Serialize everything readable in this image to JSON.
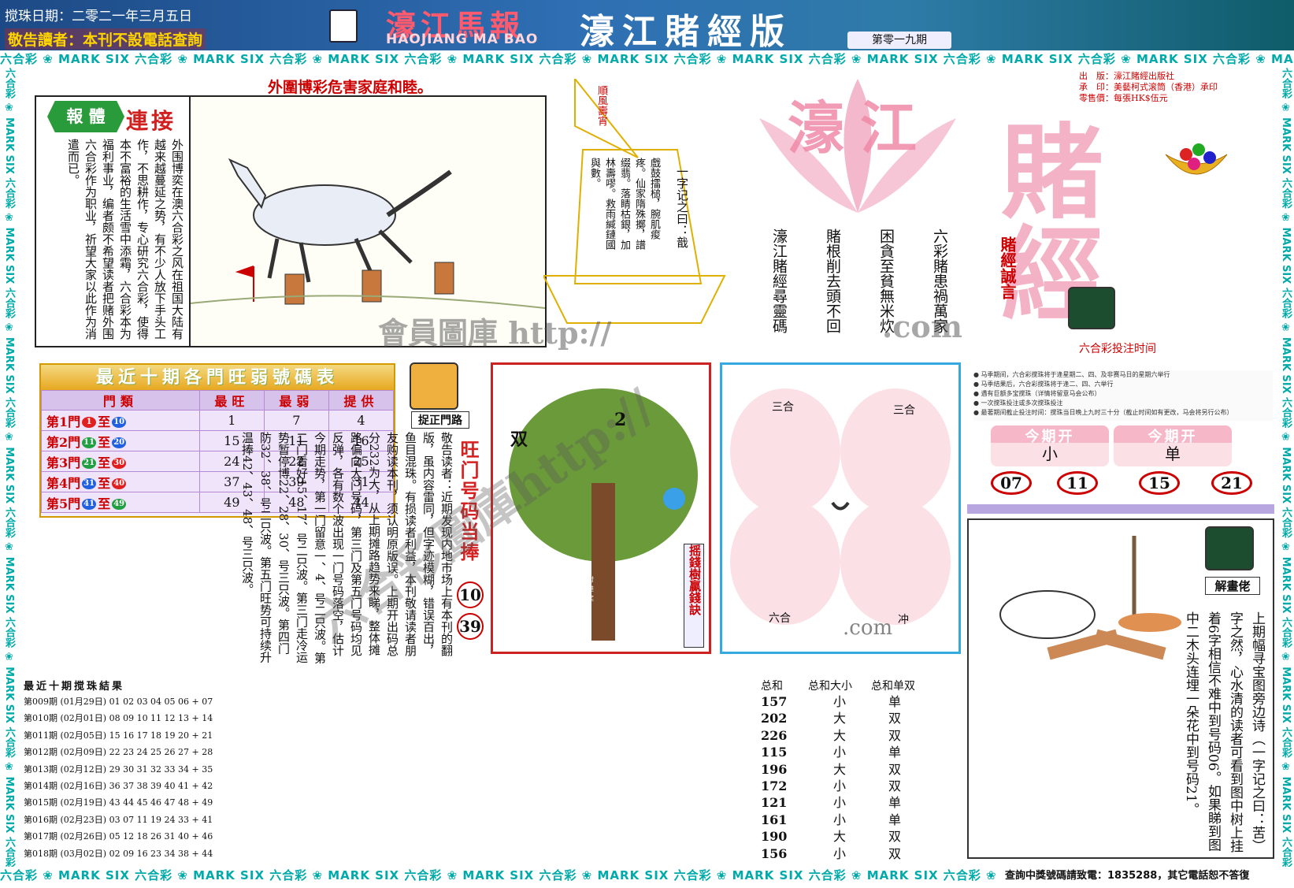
{
  "header": {
    "date": "搅珠日期：二零二一年三月五日",
    "notice": "敬告讀者：本刊不設電話查詢",
    "logo_title": "濠江馬報",
    "logo_sub": "HAOJIANG MA BAO",
    "edition": "濠江賭經版",
    "issue": "第零一九期"
  },
  "strip_text": "六合彩 ❀ MARK SIX 六合彩 ❀ MARK SIX 六合彩 ❀ MARK SIX 六合彩 ❀ MARK SIX 六合彩 ❀ MARK SIX 六合彩 ❀ MARK SIX 六合彩 ❀ MARK SIX 六合彩 ❀ MARK SIX 六合彩 ❀ MARK SIX 六合彩 ❀ MARK SIX",
  "headline": "外圍博彩危害家庭和睦。",
  "article": {
    "badge_left": "報",
    "badge_right": "體",
    "badge_title": "連接",
    "text": "外围博奕在澳六合彩之风在祖国大陆有越来越蔓延之势，有不少人放下手头工作，不思耕作，专心研究六合彩，使得本不富裕的生活雪中添霜，六合彩本为福利事业，编者颇不希望读者把赌外围六合彩作为职业，祈望大家以此作为消遣而已。"
  },
  "boat": {
    "flag": "順風壽宵",
    "poem_title": "一字记之曰：戠",
    "poem": "戲鼓擂槌，腕肌痠疼。仙家隋殊擲，譜缀翡。落睛枯銀，加林壽嘐。救雨緘鏈國與數。"
  },
  "slogans": [
    "六彩賭患禍萬家",
    "困貪至貧無米炊",
    "賭根削去頭不回",
    "濠江賭經尋靈碼"
  ],
  "right_info": {
    "publisher": "出　版：濠江賭經出版社",
    "printer": "承　印：美藝柯式滚筒（香港）承印",
    "price": "零售價：每張HK$伍元"
  },
  "banner_text": {
    "big1": "濠江",
    "big2": "賭經",
    "sub": "賭經誠言",
    "bet_time": "六合彩投注时间"
  },
  "guide_lines": [
    "● 马季期间，六合彩搅珠将于逢星期二、四、及非赛马日的星期六举行",
    "● 马季结果后，六合彩搅珠将于逢二、四、六举行",
    "● 遇有巨额多宝搅珠（详情将留意马会公布）",
    "● 一次搅珠投注或多次搅珠投注",
    "● 最著期间截止投注时间：搅珠当日晚上九时三十分（截止时间如有更改，马会将另行公布）"
  ],
  "result_tabs": [
    {
      "head": "今期开",
      "value": "小"
    },
    {
      "head": "今期开",
      "value": "单"
    }
  ],
  "result_numbers": [
    "07",
    "11",
    "15",
    "21"
  ],
  "table": {
    "title": "最近十期各門旺弱號碼表",
    "headers": [
      "門類",
      "最旺",
      "最弱",
      "提供"
    ],
    "rows": [
      {
        "gate": "第1門",
        "a": "1",
        "b": "10",
        "hot": "1",
        "cold": "7",
        "pick": "4",
        "color_a": "#e02020",
        "color_b": "#2060e0"
      },
      {
        "gate": "第2門",
        "a": "11",
        "b": "20",
        "hot": "15",
        "cold": "11",
        "pick": "16",
        "color_a": "#20a040",
        "color_b": "#2060e0"
      },
      {
        "gate": "第3門",
        "a": "21",
        "b": "30",
        "hot": "24",
        "cold": "22",
        "pick": "25",
        "color_a": "#20a040",
        "color_b": "#e02020"
      },
      {
        "gate": "第4門",
        "a": "31",
        "b": "40",
        "hot": "37",
        "cold": "39",
        "pick": "31",
        "color_a": "#2060e0",
        "color_b": "#e02020"
      },
      {
        "gate": "第5門",
        "a": "41",
        "b": "49",
        "hot": "49",
        "cold": "48",
        "pick": "44",
        "color_a": "#2060e0",
        "color_b": "#20a040"
      }
    ],
    "range_sep": "至"
  },
  "gate_label": "捉正門路",
  "gate_text": "敬告读者：近期发现内地市场上有本刊的翻版，虽内容雷同，但字迹模糊，错误百出，鱼目混珠。有损读者利益，本刊敬请读者朋友购读本刊，须认明原版误。上期开出码总分232为大，从上期摊路趋势来睇，整体摊路偏向大门号码，第三门及第五门号码均见反弹，各有数个波出现一门号码落空，估计今期走势，第一门留意一、4、号二只波。第二门看好15、17、号二只波。第三门走冷运势暂停博22、28、30、号三只波。第四门防32、38、号二只波。第五门旺势可持续升温捧42、43、48、号三只波。",
  "hot_label": "旺门号码当捧",
  "hot_numbers": [
    "10",
    "39"
  ],
  "tree": {
    "label_left": "双",
    "label_num": "2",
    "side_label": "摇錢樹贏錢訣",
    "note": "迎新年，巧蒙吉利新老读者对本刊的支持与厚爱。祝钱财进账为一肖，一尾，一双，中奖率更高"
  },
  "zodiac": {
    "tl": "三合",
    "tr": "三合",
    "bl": "六合",
    "br": "冲",
    "footer": ".com"
  },
  "cartoon": {
    "label": "解畫佬",
    "text": "上期幅寻宝图旁边诗（一字记之曰：苦）字之然，心水清的读者可看到图中树上挂着6字相信不难中到号码06。如果睇到图中二木头连埋一朵花中到号码21。"
  },
  "history": {
    "title": "最近十期搅珠結果",
    "col_sum": "总和",
    "col_size": "总和大小",
    "col_odd": "总和单双",
    "rows": [
      {
        "issue": "第009期 (01月29日)",
        "nums": "01 02 03 04 05 06 + 07",
        "sum": "157",
        "size": "小",
        "odd": "单"
      },
      {
        "issue": "第010期 (02月01日)",
        "nums": "08 09 10 11 12 13 + 14",
        "sum": "202",
        "size": "大",
        "odd": "双"
      },
      {
        "issue": "第011期 (02月05日)",
        "nums": "15 16 17 18 19 20 + 21",
        "sum": "226",
        "size": "大",
        "odd": "双"
      },
      {
        "issue": "第012期 (02月09日)",
        "nums": "22 23 24 25 26 27 + 28",
        "sum": "115",
        "size": "小",
        "odd": "单"
      },
      {
        "issue": "第013期 (02月12日)",
        "nums": "29 30 31 32 33 34 + 35",
        "sum": "196",
        "size": "大",
        "odd": "双"
      },
      {
        "issue": "第014期 (02月16日)",
        "nums": "36 37 38 39 40 41 + 42",
        "sum": "172",
        "size": "小",
        "odd": "双"
      },
      {
        "issue": "第015期 (02月19日)",
        "nums": "43 44 45 46 47 48 + 49",
        "sum": "121",
        "size": "小",
        "odd": "单"
      },
      {
        "issue": "第016期 (02月23日)",
        "nums": "03 07 11 19 24 33 + 41",
        "sum": "161",
        "size": "小",
        "odd": "单"
      },
      {
        "issue": "第017期 (02月26日)",
        "nums": "05 12 18 26 31 40 + 46",
        "sum": "190",
        "size": "大",
        "odd": "双"
      },
      {
        "issue": "第018期 (03月02日)",
        "nums": "02 09 16 23 34 38 + 44",
        "sum": "156",
        "size": "小",
        "odd": "双"
      }
    ]
  },
  "watermark": {
    "line1": "會員圖庫 http://",
    "line2": ".com",
    "line3": "六合彩圖庫http://"
  },
  "footer": {
    "tel": "查詢中獎號碼請致電：1835288，其它電話恕不答復"
  },
  "colors": {
    "red": "#c00000",
    "teal": "#00a0a0",
    "pink": "#f2a0b8",
    "blue_frame": "#36a9e1"
  }
}
